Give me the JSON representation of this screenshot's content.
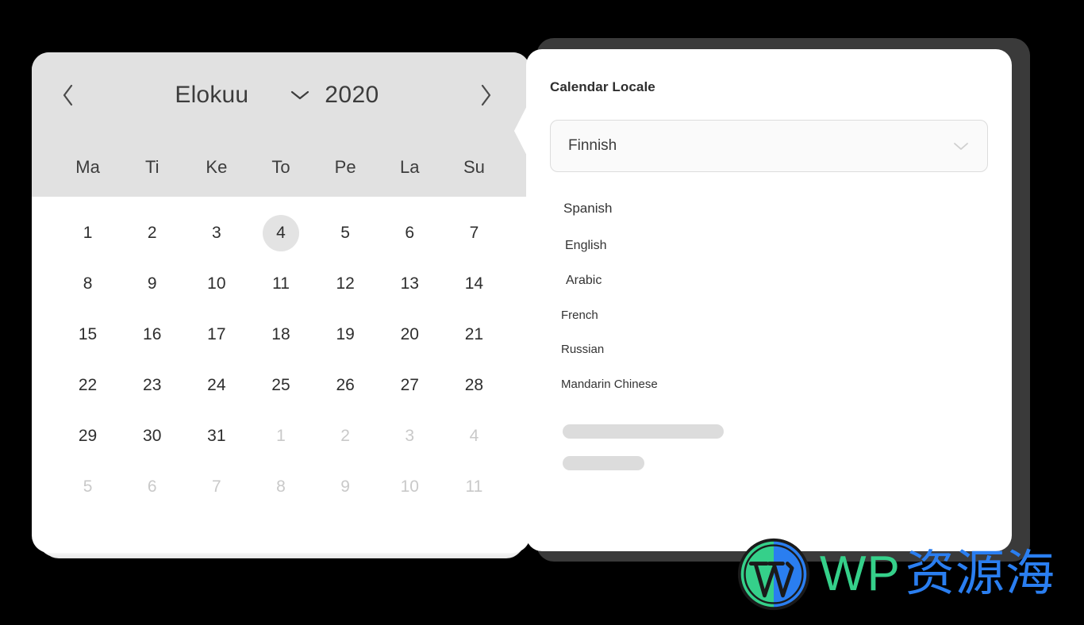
{
  "background_color": "#000000",
  "calendar": {
    "header_bg": "#e1e1e1",
    "prev_label": "‹",
    "next_label": "›",
    "month": "Elokuu",
    "year": "2020",
    "month_dropdown_icon": "chevron-down-icon",
    "weekdays": [
      "Ma",
      "Ti",
      "Ke",
      "To",
      "Pe",
      "La",
      "Su"
    ],
    "selected_day": "4",
    "weeks": [
      [
        {
          "label": "1",
          "muted": false
        },
        {
          "label": "2",
          "muted": false
        },
        {
          "label": "3",
          "muted": false
        },
        {
          "label": "4",
          "muted": false,
          "selected": true
        },
        {
          "label": "5",
          "muted": false
        },
        {
          "label": "6",
          "muted": false
        },
        {
          "label": "7",
          "muted": false
        }
      ],
      [
        {
          "label": "8",
          "muted": false
        },
        {
          "label": "9",
          "muted": false
        },
        {
          "label": "10",
          "muted": false
        },
        {
          "label": "11",
          "muted": false
        },
        {
          "label": "12",
          "muted": false
        },
        {
          "label": "13",
          "muted": false
        },
        {
          "label": "14",
          "muted": false
        }
      ],
      [
        {
          "label": "15",
          "muted": false
        },
        {
          "label": "16",
          "muted": false
        },
        {
          "label": "17",
          "muted": false
        },
        {
          "label": "18",
          "muted": false
        },
        {
          "label": "19",
          "muted": false
        },
        {
          "label": "20",
          "muted": false
        },
        {
          "label": "21",
          "muted": false
        }
      ],
      [
        {
          "label": "22",
          "muted": false
        },
        {
          "label": "23",
          "muted": false
        },
        {
          "label": "24",
          "muted": false
        },
        {
          "label": "25",
          "muted": false
        },
        {
          "label": "26",
          "muted": false
        },
        {
          "label": "27",
          "muted": false
        },
        {
          "label": "28",
          "muted": false
        }
      ],
      [
        {
          "label": "29",
          "muted": false
        },
        {
          "label": "30",
          "muted": false
        },
        {
          "label": "31",
          "muted": false
        },
        {
          "label": "1",
          "muted": true
        },
        {
          "label": "2",
          "muted": true
        },
        {
          "label": "3",
          "muted": true
        },
        {
          "label": "4",
          "muted": true
        }
      ],
      [
        {
          "label": "5",
          "muted": true
        },
        {
          "label": "6",
          "muted": true
        },
        {
          "label": "7",
          "muted": true
        },
        {
          "label": "8",
          "muted": true
        },
        {
          "label": "9",
          "muted": true
        },
        {
          "label": "10",
          "muted": true
        },
        {
          "label": "11",
          "muted": true
        }
      ]
    ]
  },
  "panel": {
    "title": "Calendar Locale",
    "select": {
      "value": "Finnish",
      "icon": "chevron-down-icon"
    },
    "options": [
      "Spanish",
      "English",
      "Arabic",
      "French",
      "Russian",
      "Mandarin Chinese"
    ],
    "skeleton_bars": 2
  },
  "watermark": {
    "logo": "wordpress-logo-icon",
    "text_latin": "WP",
    "text_cjk": "资源海",
    "color_latin": "#35d08a",
    "color_cjk": "#2a7ef0"
  }
}
